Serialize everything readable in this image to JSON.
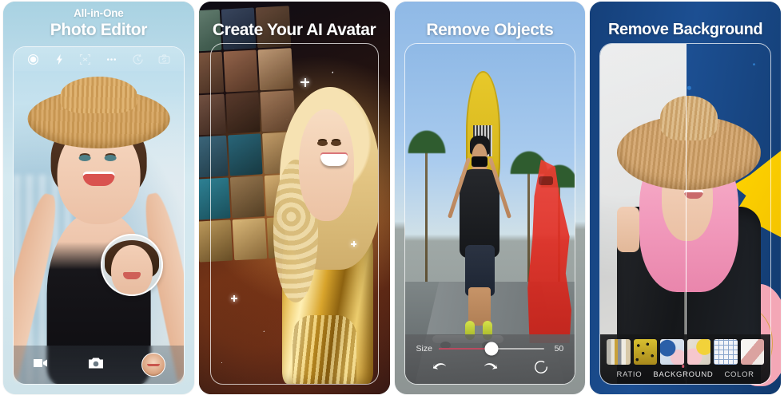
{
  "gallery": {
    "panels": [
      {
        "id": "photo-editor",
        "title_small": "All-in-One",
        "title_large": "Photo Editor",
        "top_toolbar": [
          {
            "name": "record-dot-icon",
            "glyph": "●"
          },
          {
            "name": "flash-icon",
            "glyph": "⚡"
          },
          {
            "name": "crop-frame-icon",
            "glyph": "⛶"
          },
          {
            "name": "more-options-icon",
            "glyph": "•••"
          },
          {
            "name": "timer-icon",
            "glyph": "⟳"
          },
          {
            "name": "switch-camera-icon",
            "glyph": "⧉"
          }
        ],
        "bottom_toolbar": [
          {
            "name": "video-camera-icon",
            "glyph": "▶"
          },
          {
            "name": "shutter-camera-icon",
            "glyph": "◉"
          },
          {
            "name": "gallery-avatar-thumb",
            "glyph": ""
          }
        ],
        "pip_label": "picture-in-picture-preview"
      },
      {
        "id": "ai-avatar",
        "title_large": "Create Your AI Avatar",
        "collage_swatches": [
          "#6d8a7a",
          "#3b4a63",
          "#6b4e3b",
          "#8b5f46",
          "#9d6a4f",
          "#caa27c",
          "#7e5a49",
          "#5d3d2e",
          "#a97f5e",
          "#3e6f86",
          "#276a80",
          "#c9a36e",
          "#2d8aa0",
          "#9a7b53",
          "#d9b578",
          "#c4a261",
          "#e0c07f",
          "#b9944f"
        ]
      },
      {
        "id": "remove-objects",
        "title_large": "Remove Objects",
        "slider": {
          "label": "Size",
          "value": "50",
          "percent": 50,
          "fill_color": "#bb4a60"
        },
        "buttons": [
          {
            "name": "undo-button",
            "glyph": "↩"
          },
          {
            "name": "redo-button",
            "glyph": "↪"
          },
          {
            "name": "reset-button",
            "glyph": "◯"
          }
        ]
      },
      {
        "id": "remove-background",
        "title_large": "Remove Background",
        "thumbnails": [
          {
            "name": "background-thumb-geometric",
            "colors": [
              "#d6d2c8",
              "#c9a13a",
              "#8a8f96"
            ]
          },
          {
            "name": "background-thumb-leopard",
            "colors": [
              "#1a1a14",
              "#d8c030",
              "#8a7a18"
            ]
          },
          {
            "name": "background-thumb-blue-abstract",
            "colors": [
              "#2a5fa8",
              "#f2c7cf",
              "#dfe7f0"
            ]
          },
          {
            "name": "background-thumb-yellow-abstract",
            "colors": [
              "#f2d23a",
              "#f6c7cd",
              "#e8e2d6"
            ]
          },
          {
            "name": "background-thumb-blue-plaid",
            "colors": [
              "#f2f4f8",
              "#8aa6cc",
              "#5c7fae"
            ]
          },
          {
            "name": "background-thumb-pink-diagonal",
            "colors": [
              "#f7f5f2",
              "#dba3a0",
              "#c98a88"
            ]
          }
        ],
        "tabs": [
          {
            "label": "RATIO",
            "active": false
          },
          {
            "label": "BACKGROUND",
            "active": true
          },
          {
            "label": "COLOR",
            "active": false
          }
        ],
        "active_dot_color": "#d4566c"
      }
    ]
  }
}
